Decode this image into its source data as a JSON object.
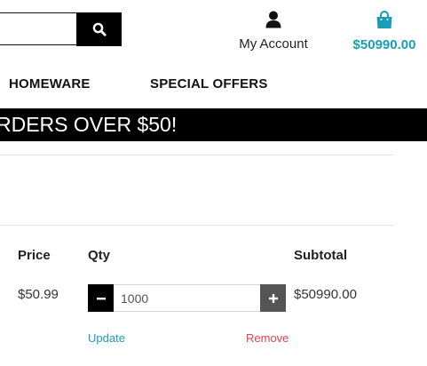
{
  "header": {
    "search": {
      "value": "",
      "placeholder": ""
    },
    "account_label": "My Account",
    "cart_total": "$50990.00"
  },
  "nav": {
    "items": [
      {
        "label": "HOMEWARE"
      },
      {
        "label": "SPECIAL OFFERS"
      }
    ]
  },
  "banner": {
    "text": "RDERS OVER $50!"
  },
  "cart_table": {
    "columns": {
      "price": "Price",
      "qty": "Qty",
      "subtotal": "Subtotal"
    },
    "row": {
      "price": "$50.99",
      "quantity": "1000",
      "subtotal": "$50990.00",
      "update_label": "Update",
      "remove_label": "Remove"
    }
  },
  "colors": {
    "accent": "#1a9db6",
    "remove": "#e0434d",
    "banner_bg": "#000000"
  },
  "icons": [
    "search-icon",
    "user-icon",
    "shopping-bag-icon",
    "minus-icon",
    "plus-icon"
  ]
}
